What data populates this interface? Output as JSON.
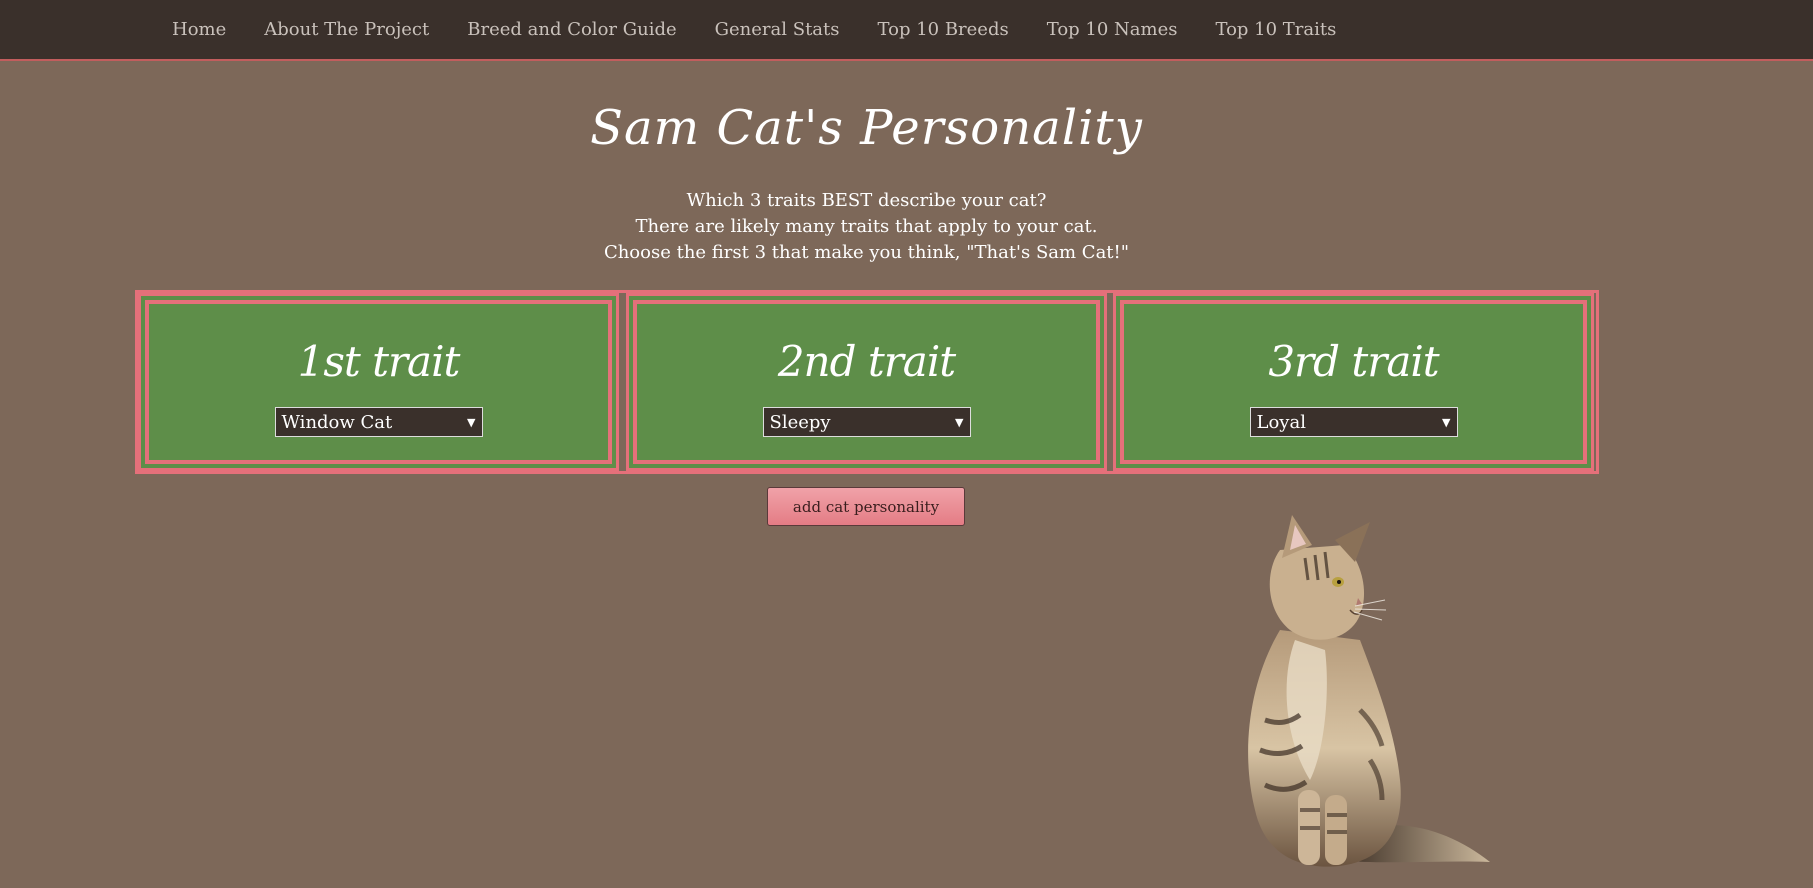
{
  "nav": {
    "items": [
      {
        "label": "Home"
      },
      {
        "label": "About The Project"
      },
      {
        "label": "Breed and Color Guide"
      },
      {
        "label": "General Stats"
      },
      {
        "label": "Top 10 Breeds"
      },
      {
        "label": "Top 10 Names"
      },
      {
        "label": "Top 10 Traits"
      }
    ]
  },
  "page": {
    "title": "Sam Cat's Personality",
    "intro_lines": [
      "Which 3 traits BEST describe your cat?",
      "There are likely many traits that apply to your cat.",
      "Choose the first 3 that make you think, \"That's Sam Cat!\""
    ]
  },
  "traits": [
    {
      "heading": "1st trait",
      "selected": "Window Cat"
    },
    {
      "heading": "2nd trait",
      "selected": "Sleepy"
    },
    {
      "heading": "3rd trait",
      "selected": "Loyal"
    }
  ],
  "button": {
    "label": "add cat personality"
  },
  "icons": {
    "select_arrow": "chevron-down-icon"
  },
  "colors": {
    "background": "#7d6859",
    "navbar": "#3a302b",
    "panel": "#5e8e49",
    "border_accent": "#e5707a",
    "button": "#e47c85"
  }
}
